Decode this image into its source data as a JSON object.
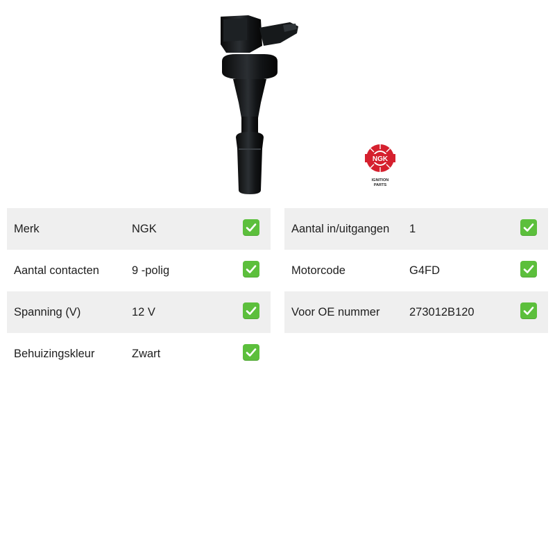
{
  "product": {
    "image_icon": "ignition-coil-image",
    "brand_logo": {
      "mark": "NGK",
      "line1": "IGNITION",
      "line2": "PARTS",
      "color": "#d5202e"
    }
  },
  "colors": {
    "row_shade": "#efefef",
    "check_green": "#5cbf3c"
  },
  "specs_left": [
    {
      "label": "Merk",
      "value": "NGK",
      "shaded": true
    },
    {
      "label": "Aantal contacten",
      "value": "9 -polig",
      "shaded": false
    },
    {
      "label": "Spanning (V)",
      "value": "12 V",
      "shaded": true
    },
    {
      "label": "Behuizingskleur",
      "value": "Zwart",
      "shaded": false
    }
  ],
  "specs_right": [
    {
      "label": "Aantal in/uitgangen",
      "value": "1",
      "shaded": true
    },
    {
      "label": "Motorcode",
      "value": "G4FD",
      "shaded": false
    },
    {
      "label": "Voor OE nummer",
      "value": "273012B120",
      "shaded": true
    }
  ],
  "check_icon": "check-mark-icon"
}
